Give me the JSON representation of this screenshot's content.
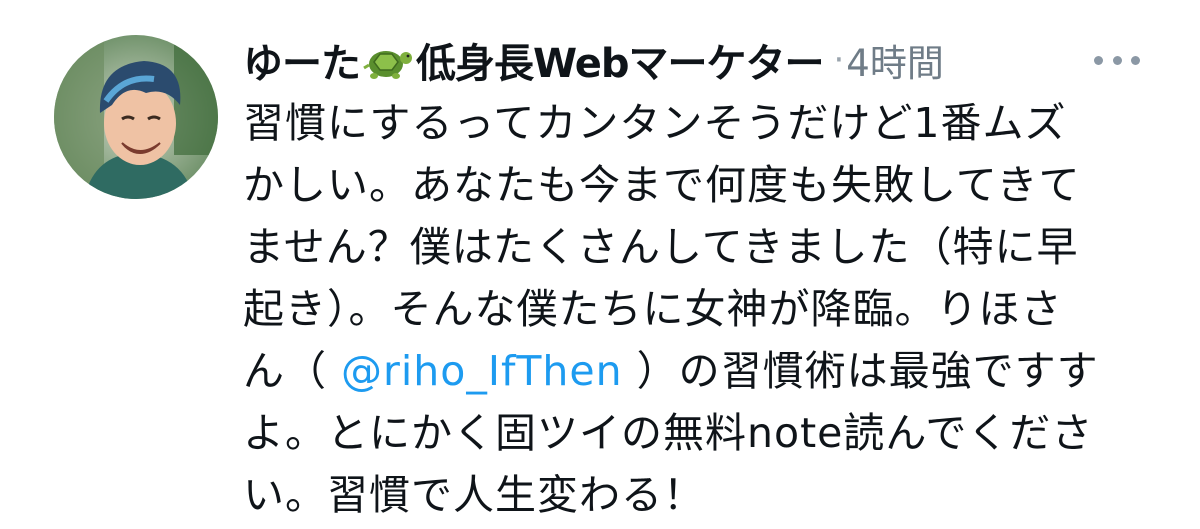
{
  "tweet": {
    "author_name_before": "ゆーた",
    "author_name_after": "低身長Webマーケター",
    "emoji": "turtle-emoji",
    "separator": "·",
    "time": "4時間",
    "more_icon": "more-horizontal-icon",
    "lines": [
      {
        "text": "習慣にするってカンタンそうだけど1番ムズ"
      },
      {
        "text": "かしい。あなたも今まで何度も失敗してきて"
      },
      {
        "text": "ません？僕はたくさんしてきました（特に早"
      },
      {
        "text": "起き）。そんな僕たちに女神が降臨。りほさ"
      },
      {
        "before": "ん（ ",
        "mention": "@riho_IfThen",
        "after": " ）の習慣術は最強ですす"
      },
      {
        "text": "よ。とにかく固ツイの無料note読んでくださ"
      },
      {
        "text": "い。習慣で人生変わる！"
      }
    ]
  },
  "colors": {
    "text": "#0f1419",
    "mention": "#1d9bf0",
    "muted": "#6f7c87"
  }
}
